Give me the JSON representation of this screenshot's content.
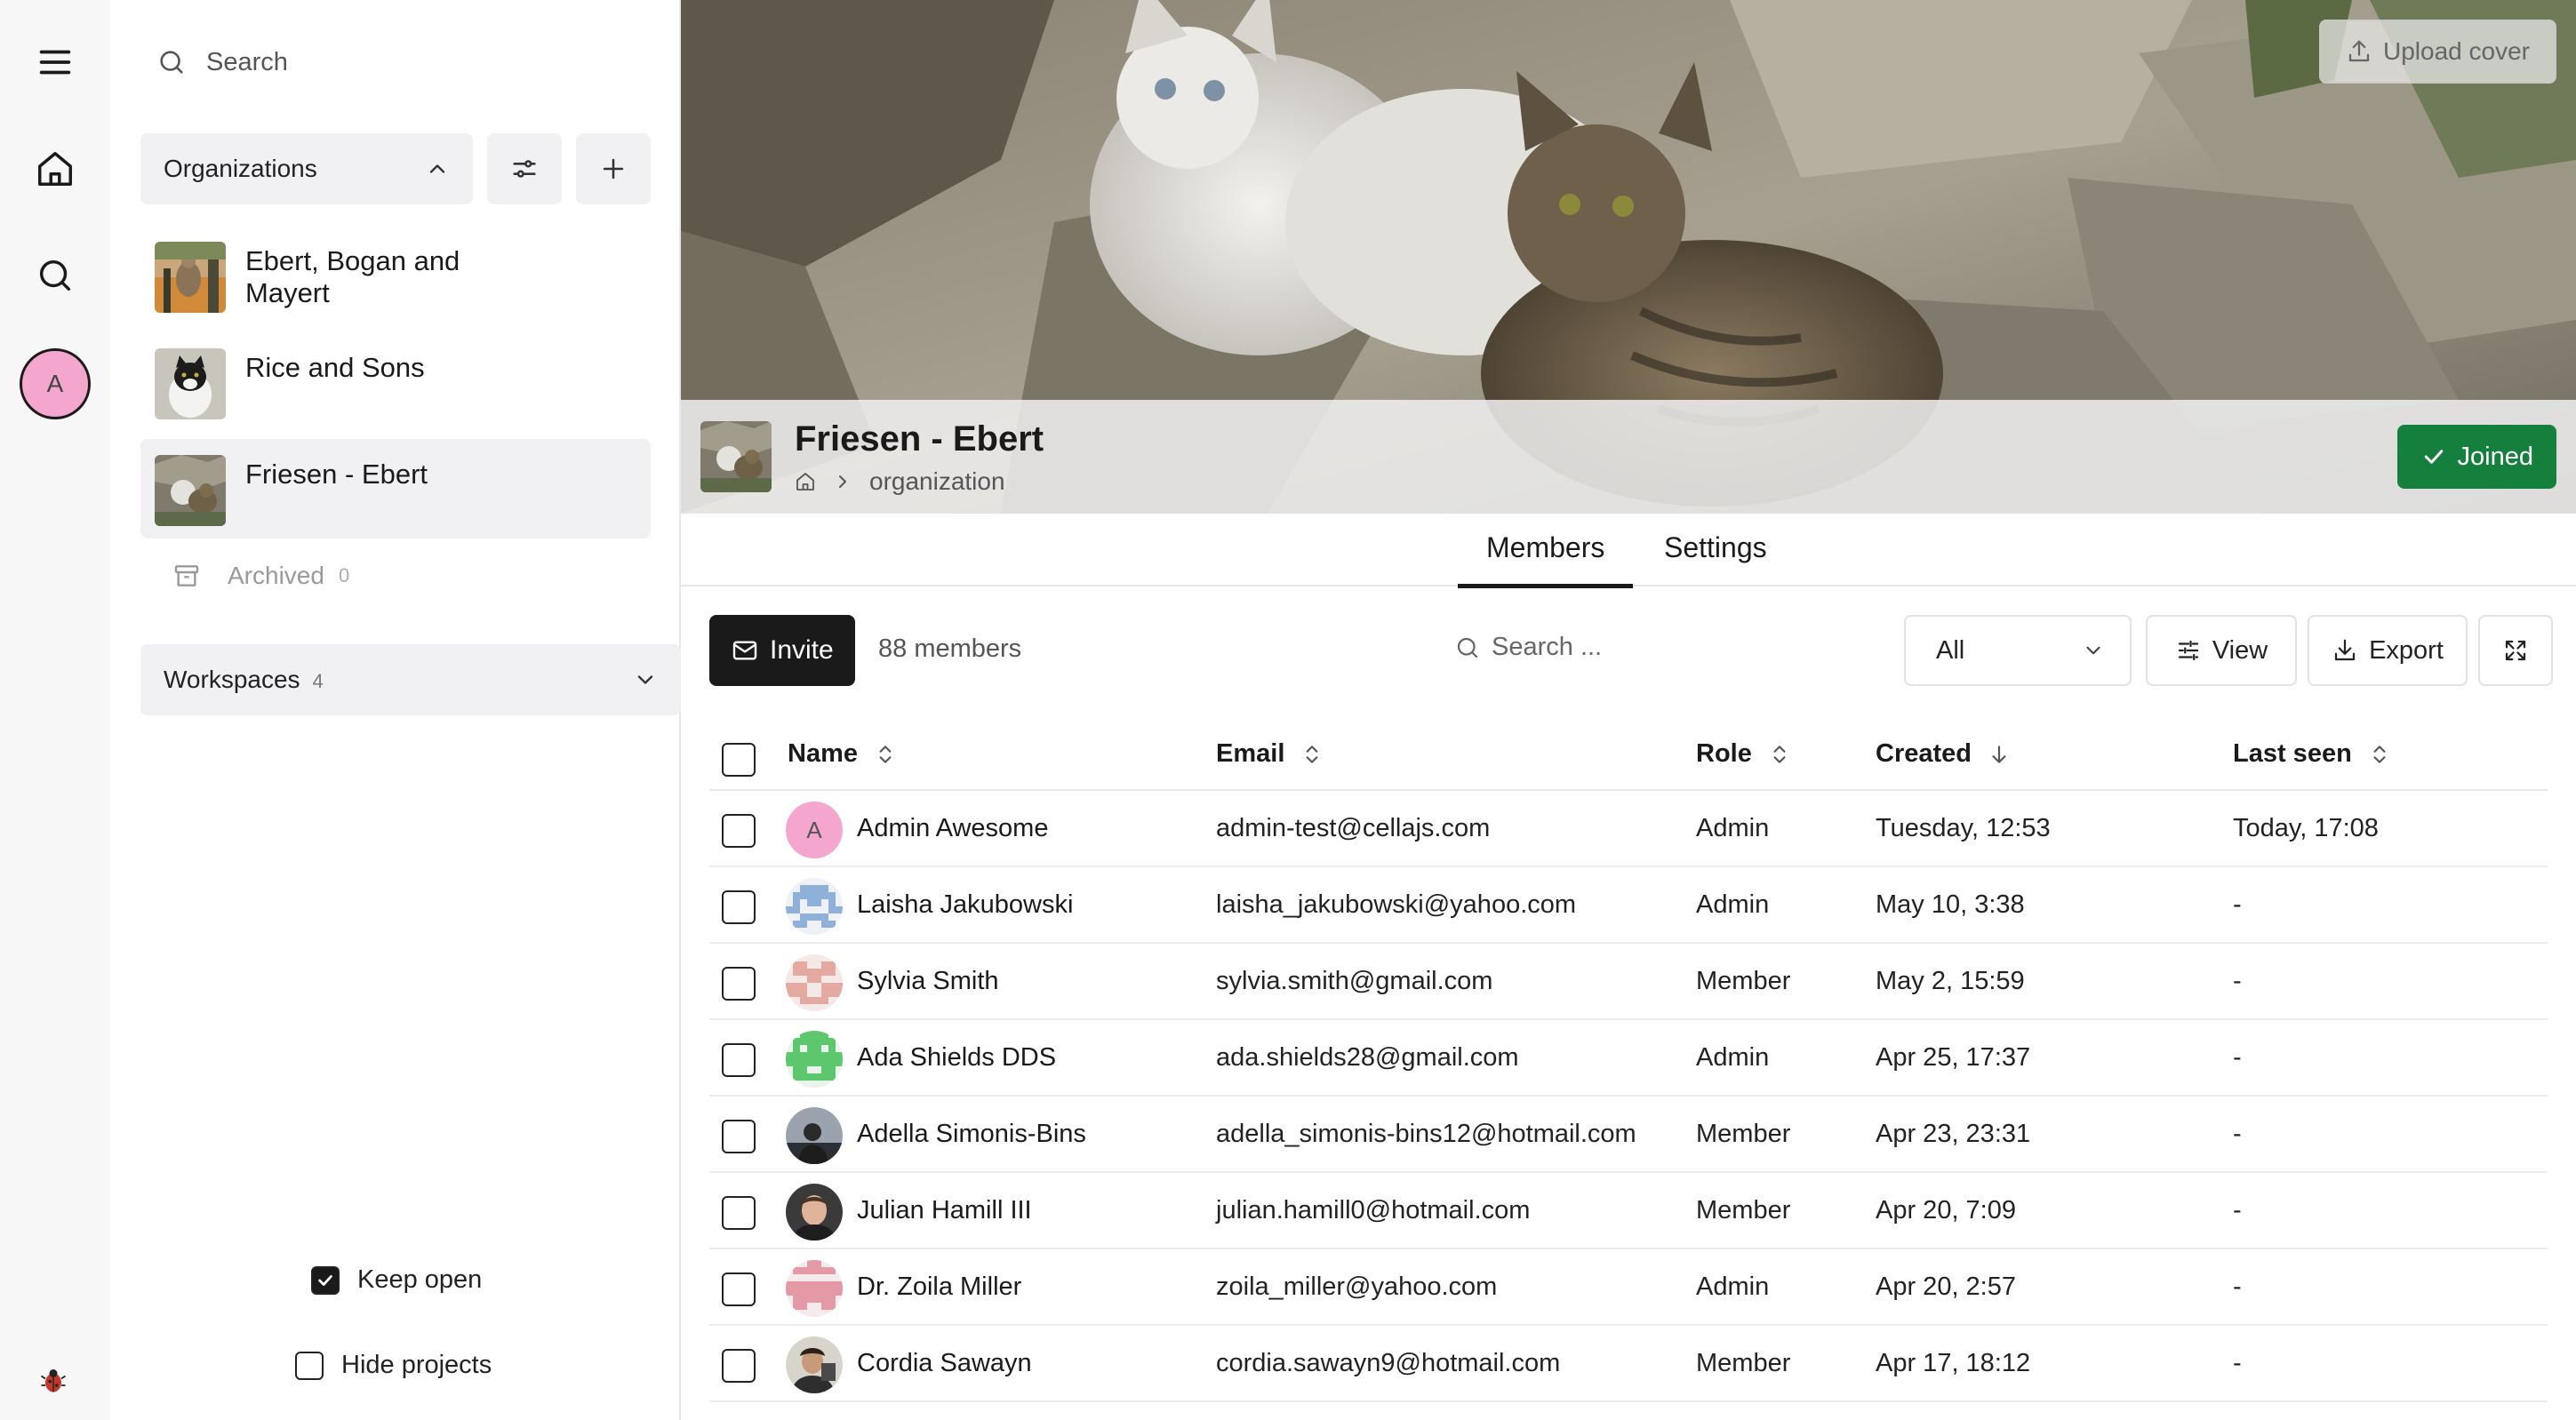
{
  "sidebar": {
    "search_placeholder": "Search",
    "organizations_label": "Organizations",
    "organizations": [
      {
        "name": "Ebert, Bogan and Mayert"
      },
      {
        "name": "Rice and Sons"
      },
      {
        "name": "Friesen - Ebert"
      }
    ],
    "archived_label": "Archived",
    "archived_count": "0",
    "workspaces_label": "Workspaces",
    "workspaces_count": "4",
    "keep_open_label": "Keep open",
    "keep_open_checked": true,
    "hide_projects_label": "Hide projects",
    "hide_projects_checked": false
  },
  "rail": {
    "avatar_initial": "A",
    "avatar_color": "#f4a6cf"
  },
  "header": {
    "upload_cover_label": "Upload cover",
    "org_title": "Friesen - Ebert",
    "breadcrumb_current": "organization",
    "joined_label": "Joined",
    "joined_color": "#15803d"
  },
  "tabs": [
    {
      "label": "Members",
      "active": true
    },
    {
      "label": "Settings",
      "active": false
    }
  ],
  "toolbar": {
    "invite_label": "Invite",
    "members_count": "88 members",
    "search_placeholder": "Search ...",
    "filter_selected": "All",
    "view_label": "View",
    "export_label": "Export"
  },
  "table": {
    "columns": {
      "name": "Name",
      "email": "Email",
      "role": "Role",
      "created": "Created",
      "last_seen": "Last seen"
    },
    "rows": [
      {
        "name": "Admin Awesome",
        "email": "admin-test@cellajs.com",
        "role": "Admin",
        "created": "Tuesday, 12:53",
        "last_seen": "Today, 17:08"
      },
      {
        "name": "Laisha Jakubowski",
        "email": "laisha_jakubowski@yahoo.com",
        "role": "Admin",
        "created": "May 10, 3:38",
        "last_seen": "-"
      },
      {
        "name": "Sylvia Smith",
        "email": "sylvia.smith@gmail.com",
        "role": "Member",
        "created": "May 2, 15:59",
        "last_seen": "-"
      },
      {
        "name": "Ada Shields DDS",
        "email": "ada.shields28@gmail.com",
        "role": "Admin",
        "created": "Apr 25, 17:37",
        "last_seen": "-"
      },
      {
        "name": "Adella Simonis-Bins",
        "email": "adella_simonis-bins12@hotmail.com",
        "role": "Member",
        "created": "Apr 23, 23:31",
        "last_seen": "-"
      },
      {
        "name": "Julian Hamill III",
        "email": "julian.hamill0@hotmail.com",
        "role": "Member",
        "created": "Apr 20, 7:09",
        "last_seen": "-"
      },
      {
        "name": "Dr. Zoila Miller",
        "email": "zoila_miller@yahoo.com",
        "role": "Admin",
        "created": "Apr 20, 2:57",
        "last_seen": "-"
      },
      {
        "name": "Cordia Sawayn",
        "email": "cordia.sawayn9@hotmail.com",
        "role": "Member",
        "created": "Apr 17, 18:12",
        "last_seen": "-"
      }
    ]
  }
}
